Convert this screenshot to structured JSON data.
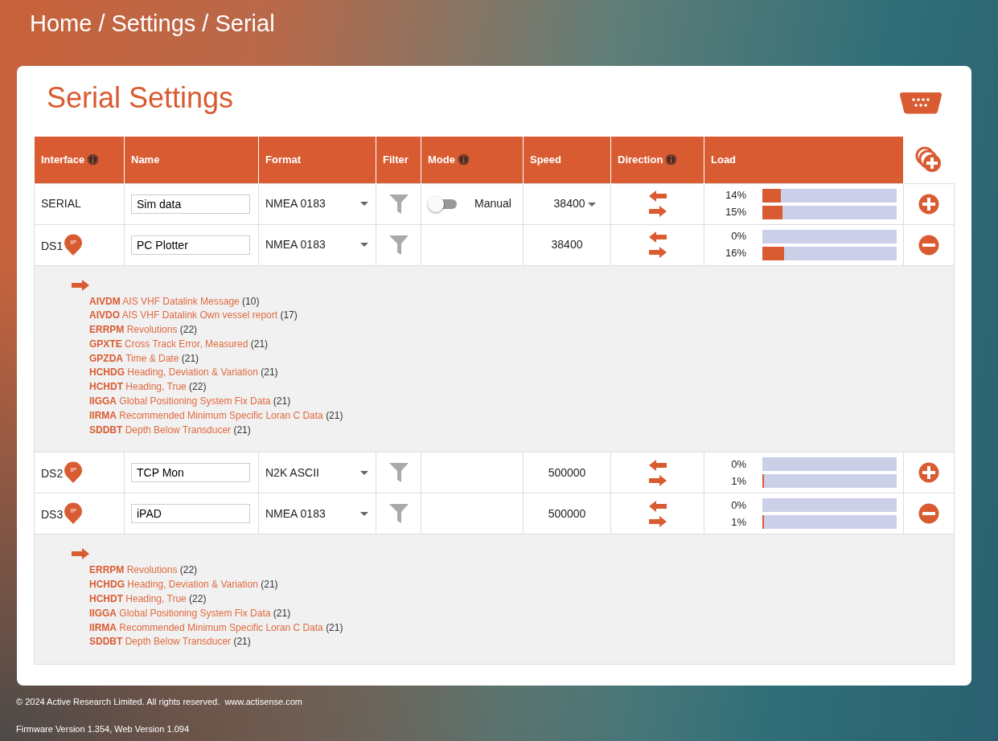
{
  "breadcrumb": "Home / Settings / Serial",
  "title": "Serial Settings",
  "columns": [
    {
      "label": "Interface",
      "info": true
    },
    {
      "label": "Name",
      "info": false
    },
    {
      "label": "Format",
      "info": false
    },
    {
      "label": "Filter",
      "info": false
    },
    {
      "label": "Mode",
      "info": true
    },
    {
      "label": "Speed",
      "info": false
    },
    {
      "label": "Direction",
      "info": true
    },
    {
      "label": "Load",
      "info": false
    }
  ],
  "rows": [
    {
      "interface": "SERIAL",
      "name": "Sim data",
      "format": "NMEA 0183",
      "mode": {
        "on": false,
        "label": "Manual"
      },
      "speed": "38400",
      "speed_select": true,
      "load": [
        {
          "text": "14%",
          "level": 0.14
        },
        {
          "text": "15%",
          "level": 0.15
        }
      ],
      "kind": "add"
    },
    {
      "interface": "DS1",
      "ip_label": "IP",
      "name": "PC Plotter",
      "format": "NMEA 0183",
      "speed": "38400",
      "speed_select": false,
      "load": [
        {
          "text": "0%",
          "level": 0
        },
        {
          "text": "16%",
          "level": 0.16
        }
      ],
      "kind": "remove",
      "messages": [
        {
          "code": "AIVDM",
          "description": "AIS VHF Datalink Message",
          "count": "(10)"
        },
        {
          "code": "AIVDO",
          "description": "AIS VHF Datalink Own vessel report",
          "count": "(17)"
        },
        {
          "code": "ERRPM",
          "description": "Revolutions",
          "count": "(22)"
        },
        {
          "code": "GPXTE",
          "description": "Cross Track Error, Measured",
          "count": "(21)"
        },
        {
          "code": "GPZDA",
          "description": "Time & Date",
          "count": "(21)"
        },
        {
          "code": "HCHDG",
          "description": "Heading, Deviation & Variation",
          "count": "(21)"
        },
        {
          "code": "HCHDT",
          "description": "Heading, True",
          "count": "(22)"
        },
        {
          "code": "IIGGA",
          "description": "Global Positioning System Fix Data",
          "count": "(21)"
        },
        {
          "code": "IIRMA",
          "description": "Recommended Minimum Specific Loran C Data",
          "count": "(21)"
        },
        {
          "code": "SDDBT",
          "description": "Depth Below Transducer",
          "count": "(21)"
        }
      ]
    },
    {
      "interface": "DS2",
      "ip_label": "IP",
      "name": "TCP Mon",
      "format": "N2K ASCII",
      "speed": "500000",
      "speed_select": false,
      "load": [
        {
          "text": "0%",
          "level": 0
        },
        {
          "text": "1%",
          "level": 0.01
        }
      ],
      "kind": "add"
    },
    {
      "interface": "DS3",
      "ip_label": "IP",
      "name": "iPAD",
      "format": "NMEA 0183",
      "speed": "500000",
      "speed_select": false,
      "load": [
        {
          "text": "0%",
          "level": 0
        },
        {
          "text": "1%",
          "level": 0.01
        }
      ],
      "kind": "remove",
      "messages": [
        {
          "code": "ERRPM",
          "description": "Revolutions",
          "count": "(22)"
        },
        {
          "code": "HCHDG",
          "description": "Heading, Deviation & Variation",
          "count": "(21)"
        },
        {
          "code": "HCHDT",
          "description": "Heading, True",
          "count": "(22)"
        },
        {
          "code": "IIGGA",
          "description": "Global Positioning System Fix Data",
          "count": "(21)"
        },
        {
          "code": "IIRMA",
          "description": "Recommended Minimum Specific Loran C Data",
          "count": "(21)"
        },
        {
          "code": "SDDBT",
          "description": "Depth Below Transducer",
          "count": "(21)"
        }
      ]
    }
  ],
  "footer": {
    "copyright": "© 2024 Active Research Limited. All rights reserved.",
    "link": "www.actisense.com",
    "version": "Firmware Version 1.354, Web Version 1.094"
  }
}
